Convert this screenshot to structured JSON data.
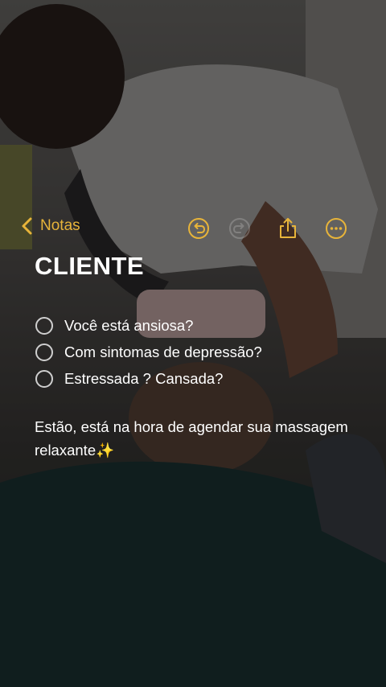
{
  "toolbar": {
    "back_label": "Notas",
    "back_icon": "chevron-left-icon",
    "undo_icon": "undo-icon",
    "redo_icon": "redo-icon",
    "share_icon": "share-icon",
    "more_icon": "more-icon",
    "accent_color": "#e7b43a"
  },
  "note": {
    "title": "CLIENTE",
    "checklist": [
      {
        "label": "Você está ansiosa?",
        "checked": false
      },
      {
        "label": "Com sintomas de depressão?",
        "checked": false
      },
      {
        "label": "Estressada ? Cansada?",
        "checked": false
      }
    ],
    "paragraph": "Estão, está na hora de agendar sua massagem relaxante",
    "sparkle": "✨"
  }
}
